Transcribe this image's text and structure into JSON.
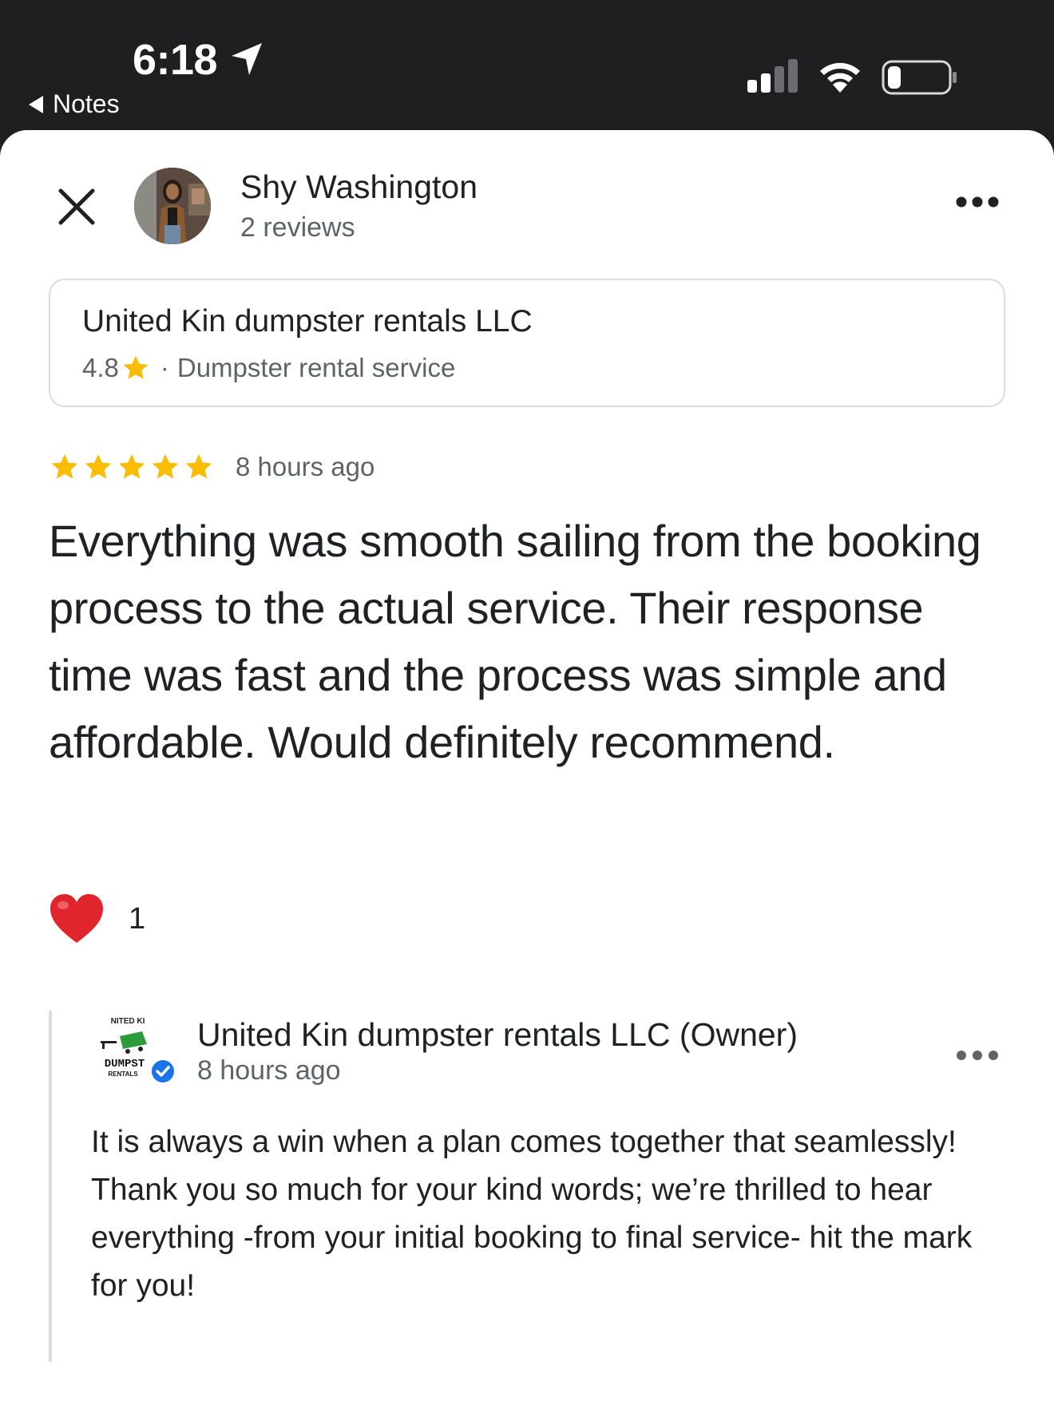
{
  "status_bar": {
    "time": "6:18",
    "back_app": "Notes"
  },
  "reviewer": {
    "name": "Shy Washington",
    "review_count": "2 reviews"
  },
  "business": {
    "name": "United Kin dumpster rentals LLC",
    "rating": "4.8",
    "separator": "·",
    "category": "Dumpster rental service"
  },
  "review": {
    "stars": 5,
    "time": "8 hours ago",
    "text": "Everything was smooth sailing from the booking process to the actual service. Their response time was fast and the process was simple and affordable. Would definitely recommend.",
    "likes": "1"
  },
  "owner_reply": {
    "name": "United Kin dumpster rentals LLC (Owner)",
    "time": "8 hours ago",
    "text": "It is always a win when a plan comes together that seamlessly! Thank you so much for your kind words; we’re thrilled to hear everything -from your initial booking to final service- hit the mark for you!",
    "logo_text_top": "NITED KI",
    "logo_text_mid": "DUMPST",
    "logo_text_bottom": "RENTALS"
  },
  "colors": {
    "star": "#fbbc04",
    "heart": "#e0262c",
    "verified": "#1a73e8",
    "status_bar_bg": "#1f1f21"
  },
  "icons": [
    "location-arrow-icon",
    "cellular-signal-icon",
    "wifi-icon",
    "battery-icon",
    "close-icon",
    "more-options-icon",
    "star-icon",
    "heart-icon",
    "verified-badge-icon"
  ]
}
